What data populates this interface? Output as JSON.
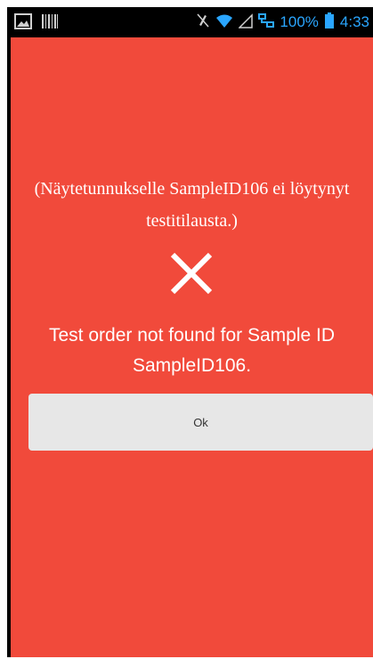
{
  "status_bar": {
    "battery_percent": "100%",
    "time": "4:33",
    "icons": [
      "image-icon",
      "barcode-icon",
      "mute-icon",
      "wifi-icon",
      "signal-icon",
      "network-icon",
      "battery-icon"
    ]
  },
  "dialog": {
    "message_fi": "(Näytetunnukselle SampleID106 ei löytynyt testitilausta.)",
    "error_icon": "close-icon",
    "message_en": "Test order not found for Sample ID SampleID106.",
    "ok_label": "Ok"
  },
  "colors": {
    "error_background": "#f14a3b",
    "button_background": "#e7e7e7",
    "status_accent": "#2aa6ff"
  }
}
